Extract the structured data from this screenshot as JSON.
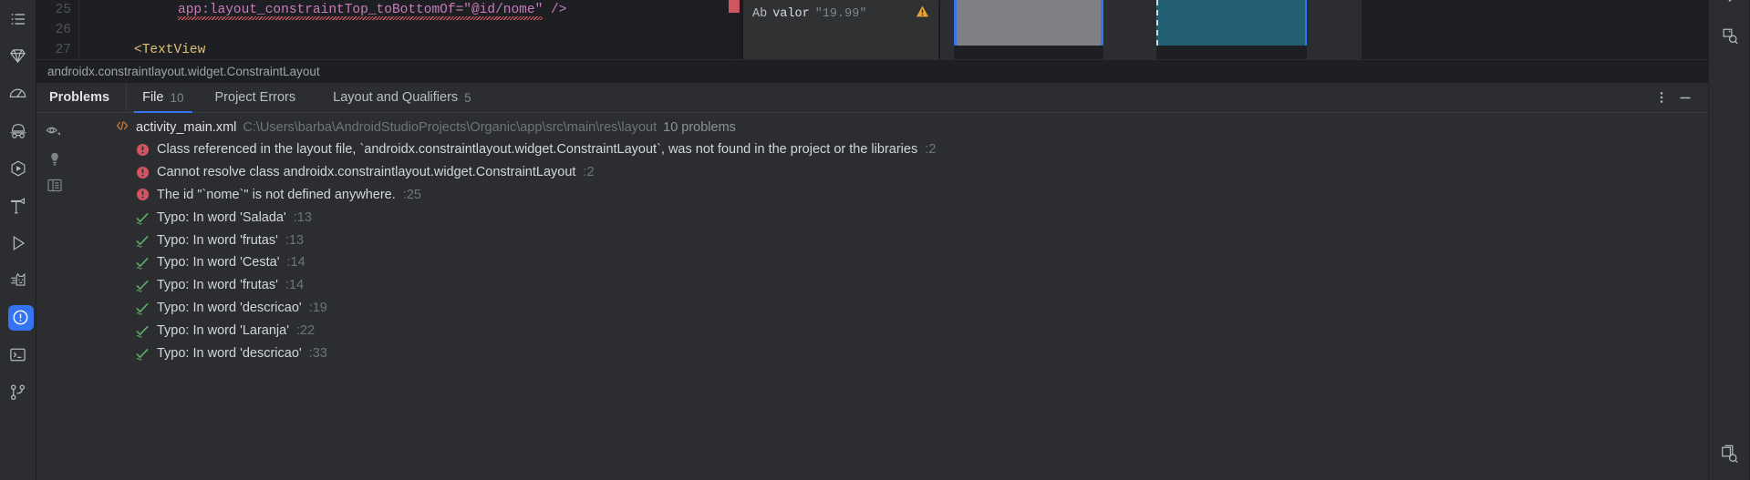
{
  "window": {
    "background": "#2b2d30",
    "accent": "#3574f0",
    "error_color": "#cf5560",
    "ok_color": "#5fad65"
  },
  "left_rail": {
    "items": [
      {
        "name": "structure-list-icon",
        "label": "Structure"
      },
      {
        "name": "gem-icon",
        "label": "Resource Manager"
      },
      {
        "name": "profiler-gauge-icon",
        "label": "Profiler"
      },
      {
        "name": "incognito-hat-icon",
        "label": "App Inspection"
      },
      {
        "name": "run-hex-icon",
        "label": "Running Devices"
      },
      {
        "name": "build-hammer-icon",
        "label": "Build"
      },
      {
        "name": "run-play-icon",
        "label": "Run"
      },
      {
        "name": "logcat-cat-icon",
        "label": "Logcat"
      },
      {
        "name": "problems-icon",
        "label": "Problems",
        "selected": true
      },
      {
        "name": "terminal-icon",
        "label": "Terminal"
      },
      {
        "name": "version-control-icon",
        "label": "Version Control"
      }
    ]
  },
  "right_rail": {
    "items": [
      {
        "name": "notifications-search-icon",
        "label": "Notifications"
      },
      {
        "name": "device-manager-search-icon",
        "label": "Device Manager"
      }
    ]
  },
  "editor": {
    "lines": [
      {
        "number": "25",
        "indent": 108,
        "segments": [
          {
            "text": "app:layout_constraintTop_toBottomOf",
            "cls": "tok-attr"
          },
          {
            "text": "=",
            "cls": "tok-val"
          },
          {
            "text": "\"@id/nome\"",
            "cls": "tok-val"
          },
          {
            "text": " />",
            "cls": "tok-val"
          }
        ],
        "squiggle": true
      },
      {
        "number": "26",
        "indent": 60,
        "segments": []
      },
      {
        "number": "27",
        "indent": 60,
        "segments": [
          {
            "text": "<TextView",
            "cls": "tok-tag"
          }
        ],
        "squiggle": false
      }
    ],
    "tooltip": {
      "prefix": "Ab",
      "name": "valor",
      "value": "\"19.99\"",
      "warn_icon": "warning-triangle-icon"
    }
  },
  "breadcrumb": {
    "text": "androidx.constraintlayout.widget.ConstraintLayout"
  },
  "panel": {
    "title": "Problems",
    "tabs": [
      {
        "label": "File",
        "count": "10",
        "active": true,
        "name": "tab-file"
      },
      {
        "label": "Project Errors",
        "count": "",
        "active": false,
        "name": "tab-project-errors"
      },
      {
        "label": "Layout and Qualifiers",
        "count": "5",
        "active": false,
        "name": "tab-layout-and-qualifiers"
      }
    ],
    "actions": [
      {
        "name": "more-options-icon",
        "glyph": "⋮"
      },
      {
        "name": "minimize-icon",
        "glyph": "—"
      }
    ],
    "gutter_icons": [
      {
        "name": "preview-eye-icon"
      },
      {
        "name": "lightbulb-icon"
      },
      {
        "name": "toggle-details-icon"
      }
    ],
    "file": {
      "icon": "xml-file-icon",
      "name": "activity_main.xml",
      "path": "C:\\Users\\barba\\AndroidStudioProjects\\Organic\\app\\src\\main\\res\\layout",
      "count_label": "10 problems"
    },
    "problems": [
      {
        "severity": "error",
        "text": "Class referenced in the layout file, `androidx.constraintlayout.widget.ConstraintLayout`, was not found in the project or the libraries",
        "line": ":2"
      },
      {
        "severity": "error",
        "text": "Cannot resolve class androidx.constraintlayout.widget.ConstraintLayout",
        "line": ":2"
      },
      {
        "severity": "error",
        "text": "The id \"`nome`\" is not defined anywhere.",
        "line": ":25"
      },
      {
        "severity": "typo",
        "text": "Typo: In word 'Salada'",
        "line": ":13"
      },
      {
        "severity": "typo",
        "text": "Typo: In word 'frutas'",
        "line": ":13"
      },
      {
        "severity": "typo",
        "text": "Typo: In word 'Cesta'",
        "line": ":14"
      },
      {
        "severity": "typo",
        "text": "Typo: In word 'frutas'",
        "line": ":14"
      },
      {
        "severity": "typo",
        "text": "Typo: In word 'descricao'",
        "line": ":19"
      },
      {
        "severity": "typo",
        "text": "Typo: In word 'Laranja'",
        "line": ":22"
      },
      {
        "severity": "typo",
        "text": "Typo: In word 'descricao'",
        "line": ":33"
      }
    ]
  }
}
